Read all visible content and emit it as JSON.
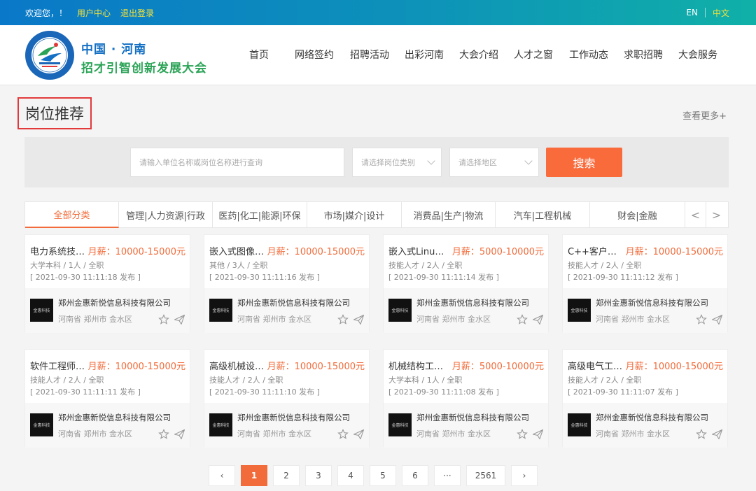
{
  "topbar": {
    "welcome": "欢迎您，！",
    "user_center": "用户中心",
    "logout": "退出登录",
    "lang_en": "EN",
    "lang_zh": "中文"
  },
  "header": {
    "logo_line1": "中国 · 河南",
    "logo_line2": "招才引智创新发展大会",
    "nav": [
      "首页",
      "网络签约",
      "招聘活动",
      "出彩河南",
      "大会介绍",
      "人才之窗",
      "工作动态",
      "求职招聘",
      "大会服务"
    ]
  },
  "section": {
    "title": "岗位推荐",
    "see_more": "查看更多+"
  },
  "search": {
    "keyword_placeholder": "请输入单位名称或岗位名称进行查询",
    "category_placeholder": "请选择岗位类别",
    "region_placeholder": "请选择地区",
    "button": "搜索"
  },
  "tabs": [
    "全部分类",
    "管理|人力资源|行政",
    "医药|化工|能源|环保",
    "市场|媒介|设计",
    "消费品|生产|物流",
    "汽车|工程机械",
    "财会|金融"
  ],
  "tab_arrows": {
    "prev": "<",
    "next": ">"
  },
  "jobs": [
    {
      "title": "电力系统技术工程师",
      "salary": "月薪：10000-15000元",
      "meta": "大学本科 / 1人 / 全职",
      "time": "[ 2021-09-30 11:11:18 发布 ]",
      "company": "郑州金惠新悦信息科技有限公司",
      "address": "河南省 郑州市 金水区"
    },
    {
      "title": "嵌入式图像算法工程师",
      "salary": "月薪：10000-15000元",
      "meta": "其他 / 3人 / 全职",
      "time": "[ 2021-09-30 11:11:16 发布 ]",
      "company": "郑州金惠新悦信息科技有限公司",
      "address": "河南省 郑州市 金水区"
    },
    {
      "title": "嵌入式Linux开发工程师",
      "salary": "月薪：5000-10000元",
      "meta": "技能人才 / 2人 / 全职",
      "time": "[ 2021-09-30 11:11:14 发布 ]",
      "company": "郑州金惠新悦信息科技有限公司",
      "address": "河南省 郑州市 金水区"
    },
    {
      "title": "C++客户端开发工程师",
      "salary": "月薪：10000-15000元",
      "meta": "技能人才 / 2人 / 全职",
      "time": "[ 2021-09-30 11:11:12 发布 ]",
      "company": "郑州金惠新悦信息科技有限公司",
      "address": "河南省 郑州市 金水区"
    },
    {
      "title": "软件工程师（Java）",
      "salary": "月薪：10000-15000元",
      "meta": "技能人才 / 2人 / 全职",
      "time": "[ 2021-09-30 11:11:11 发布 ]",
      "company": "郑州金惠新悦信息科技有限公司",
      "address": "河南省 郑州市 金水区"
    },
    {
      "title": "高级机械设计工程师",
      "salary": "月薪：10000-15000元",
      "meta": "技能人才 / 2人 / 全职",
      "time": "[ 2021-09-30 11:11:10 发布 ]",
      "company": "郑州金惠新悦信息科技有限公司",
      "address": "河南省 郑州市 金水区"
    },
    {
      "title": "机械结构工程师助理",
      "salary": "月薪：5000-10000元",
      "meta": "大学本科 / 1人 / 全职",
      "time": "[ 2021-09-30 11:11:08 发布 ]",
      "company": "郑州金惠新悦信息科技有限公司",
      "address": "河南省 郑州市 金水区"
    },
    {
      "title": "高级电气工程师",
      "salary": "月薪：10000-15000元",
      "meta": "技能人才 / 2人 / 全职",
      "time": "[ 2021-09-30 11:11:07 发布 ]",
      "company": "郑州金惠新悦信息科技有限公司",
      "address": "河南省 郑州市 金水区"
    }
  ],
  "company_logo_text": "金惠科技",
  "pagination": {
    "prev": "‹",
    "pages": [
      "1",
      "2",
      "3",
      "4",
      "5",
      "6",
      "···",
      "2561"
    ],
    "next": "›",
    "current": "1"
  },
  "colors": {
    "accent": "#f26b3a",
    "topbar_start": "#0a78c8",
    "topbar_end": "#10b0a8",
    "highlight_yellow": "#f5e23a",
    "title_border": "#e23a3a"
  }
}
